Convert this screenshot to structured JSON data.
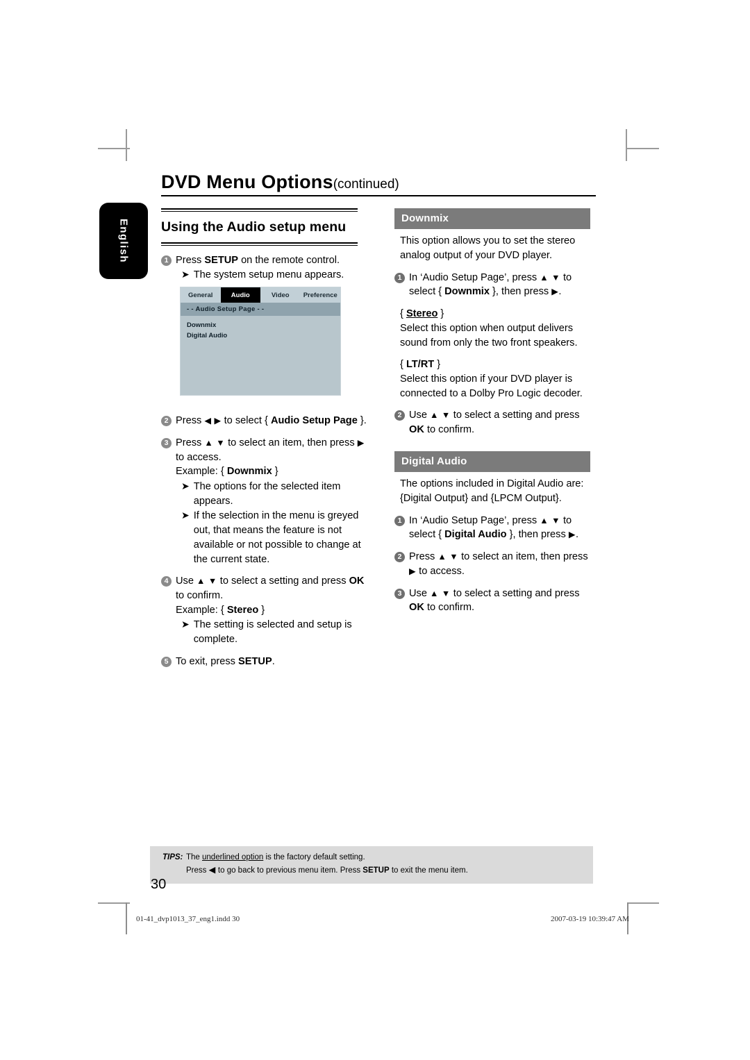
{
  "header": {
    "title": "DVD Menu Options",
    "continued": "(continued)",
    "language_tab": "English"
  },
  "left_column": {
    "section_heading": "Using the Audio setup menu",
    "steps": [
      {
        "num": "1",
        "text_parts": {
          "pre": "Press ",
          "bold": "SETUP",
          "post": " on the remote control."
        },
        "subs": [
          "The system setup menu appears."
        ]
      },
      {
        "num": "2",
        "text": "Press ◀ ▶ to select { Audio Setup Page }.",
        "subs": []
      },
      {
        "num": "3",
        "text": "Press ▲ ▼ to select an item, then press ▶ to access.",
        "example": "Example: { Downmix }",
        "subs": [
          "The options for the selected item appears.",
          "If the selection in the menu is greyed out, that means the feature is not available or not possible to change at the current state."
        ]
      },
      {
        "num": "4",
        "text": "Use ▲ ▼ to select a setting and press OK to confirm.",
        "example": "Example: { Stereo }",
        "subs": [
          "The setting is selected and setup is complete."
        ]
      },
      {
        "num": "5",
        "text": "To exit, press SETUP.",
        "subs": []
      }
    ],
    "screenshot": {
      "tabs": [
        "General",
        "Audio",
        "Video",
        "Preference"
      ],
      "active_tab": "Audio",
      "page_bar": "- -   Audio Setup Page   - -",
      "items": [
        "Downmix",
        "Digital Audio"
      ],
      "colors": {
        "background": "#b8c6cc",
        "tab_strip": "#c2d0d7",
        "active_tab": "#000000",
        "page_bar": "#8fa3ad"
      }
    }
  },
  "right_column": {
    "sections": [
      {
        "bar_title": "Downmix",
        "intro": "This option allows you to set the stereo analog output of your DVD player.",
        "steps": [
          {
            "num": "1",
            "text": "In ‘Audio Setup Page’, press ▲ ▼ to select { Downmix }, then press ▶."
          }
        ],
        "options": [
          {
            "label": "{ Stereo }",
            "label_value": "Stereo",
            "underlined": true,
            "body": "Select this option when output delivers sound from only the two front speakers."
          },
          {
            "label": "{ LT/RT }",
            "label_value": "LT/RT",
            "underlined": false,
            "body": "Select this option if your DVD player is connected to a Dolby Pro Logic decoder."
          }
        ],
        "trailing_steps": [
          {
            "num": "2",
            "text": "Use ▲ ▼ to select a setting and press OK to confirm."
          }
        ]
      },
      {
        "bar_title": "Digital Audio",
        "intro": "The options included in Digital Audio are: {Digital Output} and {LPCM Output}.",
        "steps": [
          {
            "num": "1",
            "text": "In ‘Audio Setup Page’, press ▲ ▼ to select { Digital Audio }, then press ▶."
          },
          {
            "num": "2",
            "text": "Press ▲ ▼ to select an item, then press ▶ to access."
          },
          {
            "num": "3",
            "text": "Use ▲ ▼ to select a setting and press OK to confirm."
          }
        ],
        "options": [],
        "trailing_steps": []
      }
    ],
    "bar_color": "#7b7b7b"
  },
  "tips": {
    "label": "TIPS:",
    "line1_pre": "The ",
    "line1_underlined": "underlined option",
    "line1_post": " is the factory default setting.",
    "line2_a": "Press ◀ to go back to previous menu item. Press ",
    "line2_bold": "SETUP",
    "line2_b": " to exit the menu item.",
    "background": "#dadada"
  },
  "page_number": "30",
  "print_footer": {
    "file": "01-41_dvp1013_37_eng1.indd   30",
    "timestamp": "2007-03-19   10:39:47 AM"
  }
}
